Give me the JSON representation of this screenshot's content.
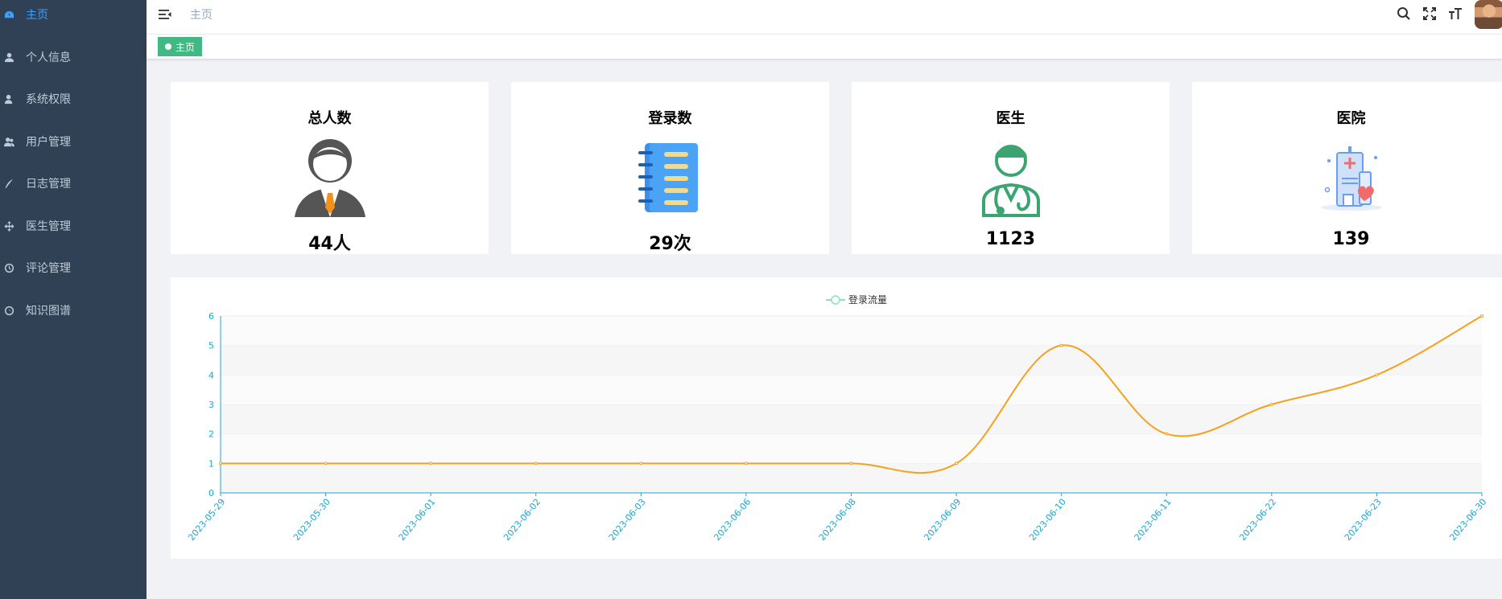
{
  "sidebar": {
    "items": [
      {
        "label": "主页",
        "icon": "dashboard-icon",
        "active": true
      },
      {
        "label": "个人信息",
        "icon": "user-icon"
      },
      {
        "label": "系统权限",
        "icon": "user-key-icon"
      },
      {
        "label": "用户管理",
        "icon": "peoples-icon"
      },
      {
        "label": "日志管理",
        "icon": "pen-icon"
      },
      {
        "label": "医生管理",
        "icon": "move-icon"
      },
      {
        "label": "评论管理",
        "icon": "clock-icon"
      },
      {
        "label": "知识图谱",
        "icon": "graph-icon"
      }
    ]
  },
  "navbar": {
    "breadcrumb": "主页",
    "icons": [
      "search-icon",
      "fullscreen-icon",
      "font-size-icon"
    ]
  },
  "tags": [
    {
      "label": "主页",
      "active": true
    }
  ],
  "cards": [
    {
      "title": "总人数",
      "value": "44人",
      "icon": "person-icon"
    },
    {
      "title": "登录数",
      "value": "29次",
      "icon": "notebook-icon"
    },
    {
      "title": "医生",
      "value": "1123",
      "icon": "doctor-icon"
    },
    {
      "title": "医院",
      "value": "139",
      "icon": "hospital-icon"
    }
  ],
  "colors": {
    "sidebar_bg": "#304156",
    "accent": "#409eff",
    "tag": "#42b983",
    "line": "#f4a21d",
    "axis": "#1aa6d0"
  },
  "chart_data": {
    "type": "line",
    "legend": [
      "登录流量"
    ],
    "legend_position": "top-center",
    "x": [
      "2023-05-29",
      "2023-05-30",
      "2023-06-01",
      "2023-06-02",
      "2023-06-03",
      "2023-06-06",
      "2023-06-08",
      "2023-06-09",
      "2023-06-10",
      "2023-06-11",
      "2023-06-22",
      "2023-06-23",
      "2023-06-30"
    ],
    "series": [
      {
        "name": "登录流量",
        "smooth": true,
        "values": [
          1,
          1,
          1,
          1,
          1,
          1,
          1,
          1,
          5,
          2,
          3,
          4,
          6
        ]
      }
    ],
    "yticks": [
      "0",
      "1",
      "2",
      "3",
      "4",
      "5",
      "6"
    ],
    "ylim": [
      0,
      6
    ],
    "grid": true
  }
}
